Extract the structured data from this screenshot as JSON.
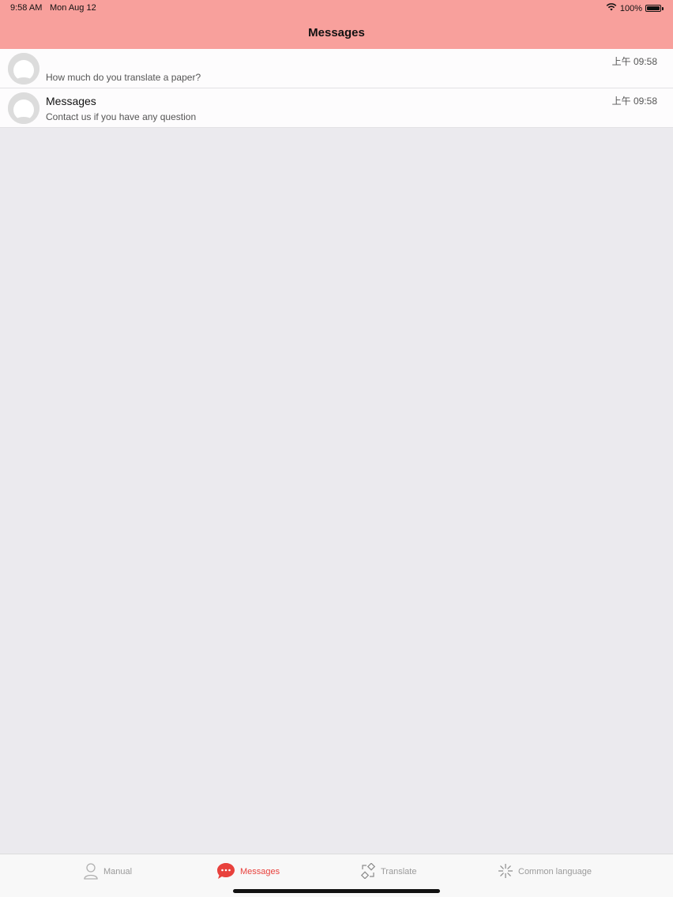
{
  "status_bar": {
    "time": "9:58 AM",
    "date": "Mon Aug 12",
    "battery": "100%"
  },
  "nav": {
    "title": "Messages"
  },
  "messages": [
    {
      "title": "",
      "preview": "How much do you translate a paper?",
      "time": "上午 09:58"
    },
    {
      "title": "Messages",
      "preview": "Contact us if you have any question",
      "time": "上午 09:58"
    }
  ],
  "tabbar": {
    "tabs": [
      {
        "label": "Manual",
        "icon": "person-icon",
        "active": false
      },
      {
        "label": "Messages",
        "icon": "chat-bubble-icon",
        "active": true
      },
      {
        "label": "Translate",
        "icon": "translate-icon",
        "active": false
      },
      {
        "label": "Common language",
        "icon": "sparkle-icon",
        "active": false
      }
    ]
  },
  "colors": {
    "header": "#f8a09c",
    "accent": "#e8413c",
    "background": "#ebeaee"
  }
}
